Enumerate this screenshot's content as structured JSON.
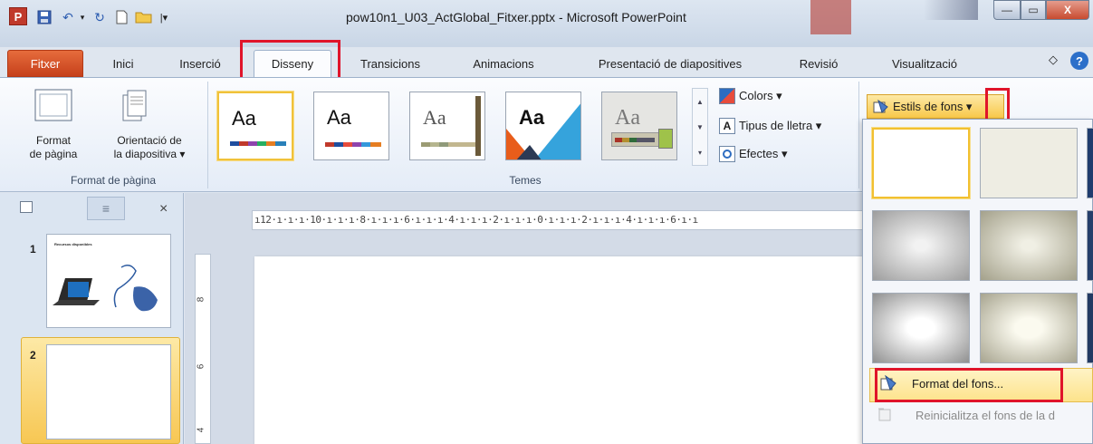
{
  "window": {
    "title": "pow10n1_U03_ActGlobal_Fitxer.pptx - Microsoft PowerPoint",
    "app_icon_letter": "P",
    "min": "—",
    "max": "▭",
    "close": "X"
  },
  "tabs": [
    {
      "label": "Fitxer"
    },
    {
      "label": "Inici"
    },
    {
      "label": "Inserció"
    },
    {
      "label": "Disseny"
    },
    {
      "label": "Transicions"
    },
    {
      "label": "Animacions"
    },
    {
      "label": "Presentació de diapositives"
    },
    {
      "label": "Revisió"
    },
    {
      "label": "Visualització"
    }
  ],
  "active_tab": "Disseny",
  "ribbon": {
    "page_setup": {
      "format_label_1": "Format",
      "format_label_2": "de pàgina",
      "orient_label_1": "Orientació de",
      "orient_label_2": "la diapositiva ▾",
      "group_label": "Format de pàgina"
    },
    "themes": {
      "group_label": "Temes",
      "items": [
        {
          "text": "Aa",
          "font": "sans"
        },
        {
          "text": "Aa",
          "font": "sans"
        },
        {
          "text": "Aa",
          "font": "serif"
        },
        {
          "text": "Aa",
          "font": "sans"
        },
        {
          "text": "Aa",
          "font": "serif"
        }
      ]
    },
    "theme_cmds": {
      "colors": "Colors ▾",
      "fonts": "Tipus de lletra ▾",
      "fonts_icon_letter": "A",
      "effects": "Efectes ▾"
    },
    "background": {
      "styles_label": "Estils de fons ▾"
    }
  },
  "ruler": {
    "horizontal": "ı12·ı·ı·ı·10·ı·ı·ı·8·ı·ı·ı·6·ı·ı·ı·4·ı·ı·ı·2·ı·ı·ı·0·ı·ı·ı·2·ı·ı·ı·4·ı·ı·ı·6·ı·ı",
    "vertical_marks": [
      "8",
      "6",
      "4"
    ]
  },
  "slides": [
    {
      "number": "1",
      "title": "Recursos disponibles"
    },
    {
      "number": "2",
      "title": ""
    }
  ],
  "gallery_menu": {
    "format_background": "Format del fons...",
    "reset_background": "Reinicialitza el fons de la d"
  },
  "colors": {
    "accent_red": "#e0142a",
    "selection_gold": "#f7c753",
    "file_tab": "#d0502a"
  }
}
